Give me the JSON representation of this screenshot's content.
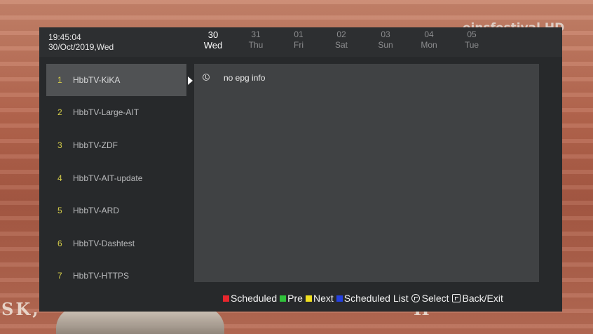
{
  "background": {
    "logo_text": "einsfestival HD",
    "caption_left": "SK,",
    "caption_right": "H"
  },
  "header": {
    "time": "19:45:04",
    "date": "30/Oct/2019,Wed",
    "days": [
      {
        "num": "30",
        "weekday": "Wed",
        "active": true
      },
      {
        "num": "31",
        "weekday": "Thu",
        "active": false
      },
      {
        "num": "01",
        "weekday": "Fri",
        "active": false
      },
      {
        "num": "02",
        "weekday": "Sat",
        "active": false
      },
      {
        "num": "03",
        "weekday": "Sun",
        "active": false
      },
      {
        "num": "04",
        "weekday": "Mon",
        "active": false
      },
      {
        "num": "05",
        "weekday": "Tue",
        "active": false
      }
    ]
  },
  "channels": [
    {
      "num": "1",
      "name": "HbbTV-KiKA",
      "selected": true
    },
    {
      "num": "2",
      "name": "HbbTV-Large-AIT",
      "selected": false
    },
    {
      "num": "3",
      "name": "HbbTV-ZDF",
      "selected": false
    },
    {
      "num": "4",
      "name": "HbbTV-AIT-update",
      "selected": false
    },
    {
      "num": "5",
      "name": "HbbTV-ARD",
      "selected": false
    },
    {
      "num": "6",
      "name": "HbbTV-Dashtest",
      "selected": false
    },
    {
      "num": "7",
      "name": "HbbTV-HTTPS",
      "selected": false
    }
  ],
  "epg": {
    "message": "no epg info",
    "icon": "clock-icon"
  },
  "legend": [
    {
      "key": "scheduled",
      "label": "Scheduled",
      "color": "#e8262d"
    },
    {
      "key": "pre",
      "label": "Pre",
      "color": "#2fc13a"
    },
    {
      "key": "next",
      "label": "Next",
      "color": "#f0e020"
    },
    {
      "key": "scheduled-list",
      "label": "Scheduled List",
      "color": "#2440e0"
    },
    {
      "key": "select",
      "label": "Select",
      "icon": "ok-icon"
    },
    {
      "key": "back-exit",
      "label": "Back/Exit",
      "icon": "back-icon"
    }
  ]
}
